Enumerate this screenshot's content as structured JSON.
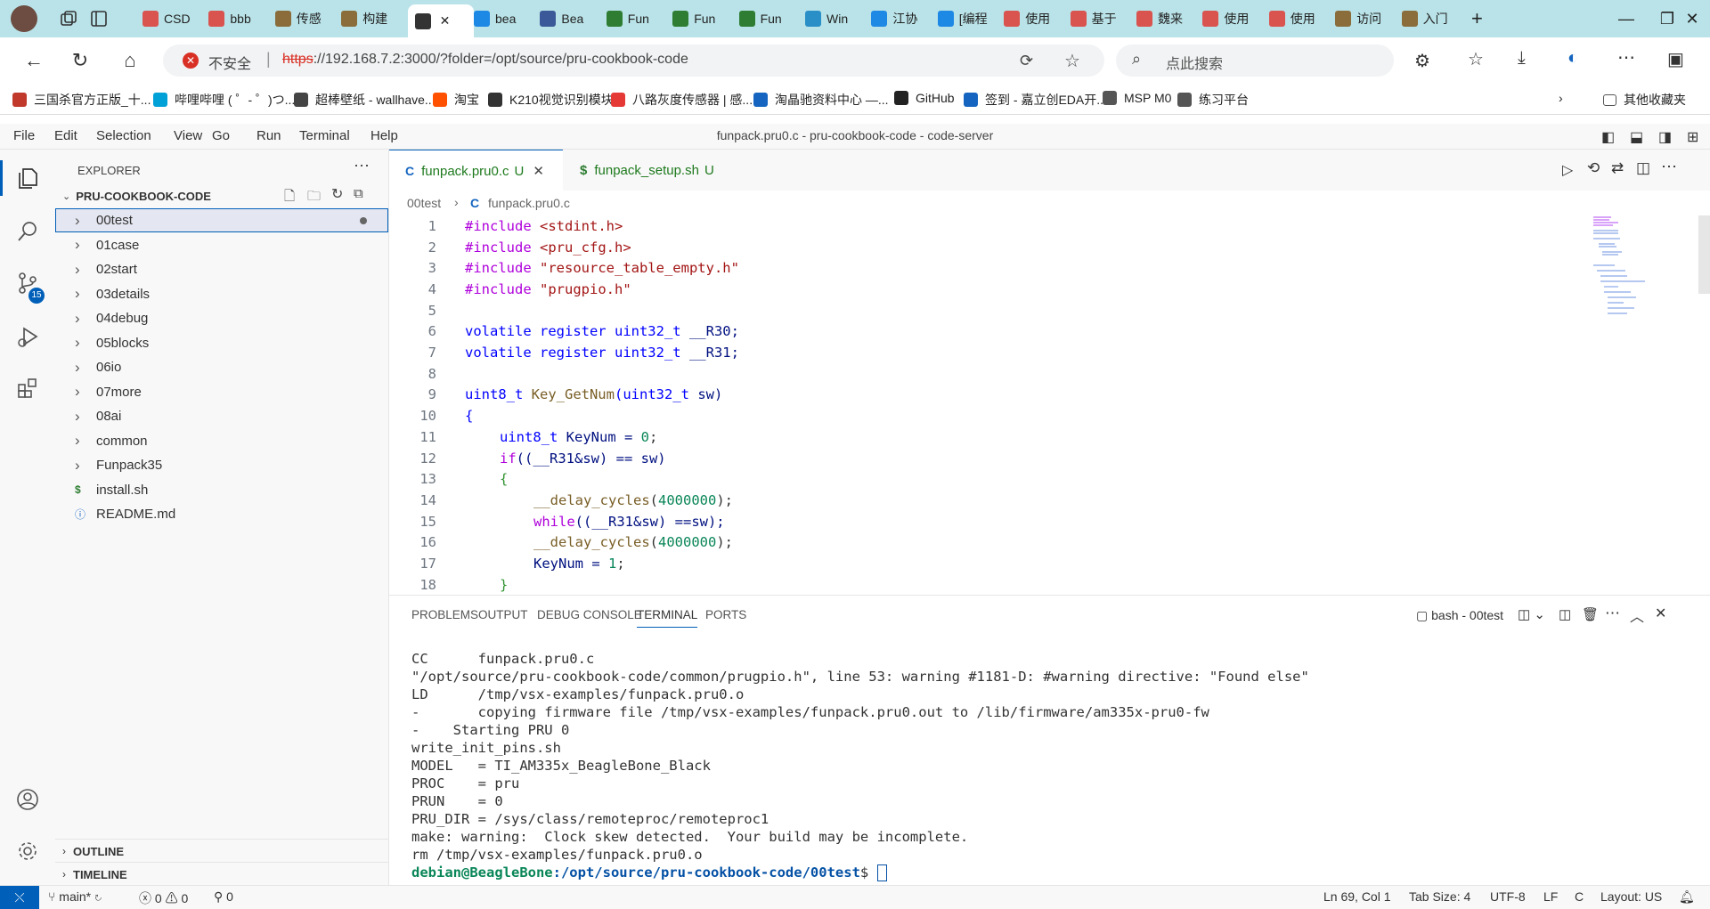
{
  "browser": {
    "tabs": [
      {
        "label": "CSD",
        "color": "#d9534f"
      },
      {
        "label": "bbb",
        "color": "#d9534f"
      },
      {
        "label": "传感",
        "color": "#8a6d3b"
      },
      {
        "label": "构建",
        "color": "#8a6d3b"
      },
      {
        "label": "",
        "color": "#333333"
      },
      {
        "label": "bea",
        "color": "#1e88e5"
      },
      {
        "label": "Bea",
        "color": "#3b5998"
      },
      {
        "label": "Fun",
        "color": "#2e7d32"
      },
      {
        "label": "Fun",
        "color": "#2e7d32"
      },
      {
        "label": "Fun",
        "color": "#2e7d32"
      },
      {
        "label": "Win",
        "color": "#2a8fc7"
      },
      {
        "label": "江协",
        "color": "#1e88e5"
      },
      {
        "label": "[编程",
        "color": "#1e88e5"
      },
      {
        "label": "使用",
        "color": "#d9534f"
      },
      {
        "label": "基于",
        "color": "#d9534f"
      },
      {
        "label": "魏来",
        "color": "#d9534f"
      },
      {
        "label": "使用",
        "color": "#d9534f"
      },
      {
        "label": "使用",
        "color": "#d9534f"
      },
      {
        "label": "访问",
        "color": "#8a6d3b"
      },
      {
        "label": "入门",
        "color": "#8a6d3b"
      }
    ],
    "insecure_label": "不安全",
    "url_scheme": "https",
    "url_rest": "://192.168.7.2:3000/?folder=/opt/source/pru-cookbook-code",
    "search_placeholder": "点此搜索",
    "bookmarks": [
      {
        "label": "三国杀官方正版_十...",
        "color": "#c0392b"
      },
      {
        "label": "哔哩哔哩 ( ゜- ゜)つ...",
        "color": "#00a1d6"
      },
      {
        "label": "超棒壁纸 - wallhave...",
        "color": "#444444"
      },
      {
        "label": "淘宝",
        "color": "#ff5000"
      },
      {
        "label": "K210视觉识别模块",
        "color": "#333333"
      },
      {
        "label": "八路灰度传感器 | 感...",
        "color": "#e53935"
      },
      {
        "label": "淘晶驰资料中心 —...",
        "color": "#1565c0"
      },
      {
        "label": "GitHub",
        "color": "#222222"
      },
      {
        "label": "签到 - 嘉立创EDA开...",
        "color": "#1565c0"
      },
      {
        "label": "MSP M0",
        "color": "#555555"
      },
      {
        "label": "练习平台",
        "color": "#555555"
      }
    ],
    "other_bookmarks": "其他收藏夹"
  },
  "vscode": {
    "menu": [
      "File",
      "Edit",
      "Selection",
      "View",
      "Go",
      "Run",
      "Terminal",
      "Help"
    ],
    "window_title": "funpack.pru0.c - pru-cookbook-code - code-server",
    "explorer_title": "EXPLORER",
    "root_folder": "PRU-COOKBOOK-CODE",
    "scm_badge": "15",
    "tree": [
      {
        "label": "00test",
        "type": "folder"
      },
      {
        "label": "01case",
        "type": "folder"
      },
      {
        "label": "02start",
        "type": "folder"
      },
      {
        "label": "03details",
        "type": "folder"
      },
      {
        "label": "04debug",
        "type": "folder"
      },
      {
        "label": "05blocks",
        "type": "folder"
      },
      {
        "label": "06io",
        "type": "folder"
      },
      {
        "label": "07more",
        "type": "folder"
      },
      {
        "label": "08ai",
        "type": "folder"
      },
      {
        "label": "common",
        "type": "folder"
      },
      {
        "label": "Funpack35",
        "type": "folder"
      },
      {
        "label": "install.sh",
        "type": "sh"
      },
      {
        "label": "README.md",
        "type": "md"
      }
    ],
    "outline": "OUTLINE",
    "timeline": "TIMELINE",
    "editor_tabs": [
      {
        "label": "funpack.pru0.c",
        "status": "U",
        "icon": "C"
      },
      {
        "label": "funpack_setup.sh",
        "status": "U",
        "icon": "$"
      }
    ],
    "breadcrumb": {
      "folder": "00test",
      "file": "funpack.pru0.c"
    },
    "code_lines": [
      "1",
      "2",
      "3",
      "4",
      "5",
      "6",
      "7",
      "8",
      "9",
      "10",
      "11",
      "12",
      "13",
      "14",
      "15",
      "16",
      "17",
      "18"
    ],
    "code": {
      "l1a": "#include ",
      "l1b": "<stdint.h>",
      "l2a": "#include ",
      "l2b": "<pru_cfg.h>",
      "l3a": "#include ",
      "l3b": "\"resource_table_empty.h\"",
      "l4a": "#include ",
      "l4b": "\"prugpio.h\"",
      "l6a": "volatile register ",
      "l6b": "uint32_t",
      "l6c": " __R30;",
      "l7a": "volatile register ",
      "l7b": "uint32_t",
      "l7c": " __R31;",
      "l9a": "uint8_t ",
      "l9b": "Key_GetNum",
      "l9c": "(",
      "l9d": "uint32_t",
      "l9e": " sw)",
      "l10": "{",
      "l11a": "uint8_t ",
      "l11b": "KeyNum = ",
      "l11c": "0",
      "l11d": ";",
      "l12a": "if",
      "l12b": "((__R31&sw) == sw)",
      "l13": "{",
      "l14a": "__delay_cycles",
      "l14b": "(",
      "l14c": "4000000",
      "l14d": ");",
      "l15a": "while",
      "l15b": "((__R31&sw) ==sw);",
      "l16a": "__delay_cycles",
      "l16b": "(",
      "l16c": "4000000",
      "l16d": ");",
      "l17a": "KeyNum = ",
      "l17b": "1",
      "l17c": ";",
      "l18": "}"
    },
    "panel_tabs": [
      "PROBLEMS",
      "OUTPUT",
      "DEBUG CONSOLE",
      "TERMINAL",
      "PORTS"
    ],
    "terminal_name": "bash - 00test",
    "terminal_lines": [
      "CC      funpack.pru0.c",
      "\"/opt/source/pru-cookbook-code/common/prugpio.h\", line 53: warning #1181-D: #warning directive: \"Found else\"",
      "LD      /tmp/vsx-examples/funpack.pru0.o",
      "-       copying firmware file /tmp/vsx-examples/funpack.pru0.out to /lib/firmware/am335x-pru0-fw",
      "-    Starting PRU 0",
      "write_init_pins.sh",
      "MODEL   = TI_AM335x_BeagleBone_Black",
      "PROC    = pru",
      "PRUN    = 0",
      "PRU_DIR = /sys/class/remoteproc/remoteproc1",
      "make: warning:  Clock skew detected.  Your build may be incomplete.",
      "rm /tmp/vsx-examples/funpack.pru0.o"
    ],
    "prompt_user": "debian@BeagleBone",
    "prompt_path": ":/opt/source/pru-cookbook-code/00test",
    "prompt_end": "$ ",
    "status": {
      "branch": "main*",
      "errors": "0",
      "warnings": "0",
      "ports": "0",
      "position": "Ln 69, Col 1",
      "tab_size": "Tab Size: 4",
      "encoding": "UTF-8",
      "eol": "LF",
      "language": "C",
      "layout": "Layout: US"
    }
  },
  "colors": {
    "accent": "#005fb8",
    "link_red": "#d93025",
    "prompt_green": "#098658",
    "prompt_blue": "#0451a5"
  }
}
